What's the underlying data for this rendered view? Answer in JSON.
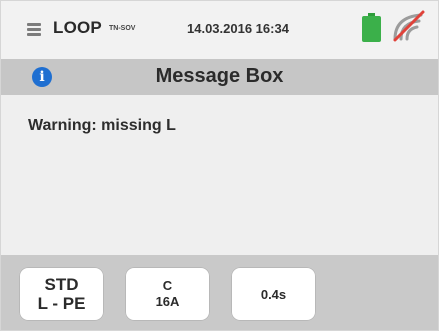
{
  "status_bar": {
    "mode": "LOOP",
    "mode_subscript": "TN-SOV",
    "datetime": "14.03.2016 16:34",
    "battery_icon": "battery-full-icon",
    "battery_color": "#3bb04a",
    "signal_icon": "signal-off-icon",
    "signal_off_color": "#e0423a"
  },
  "title_bar": {
    "icon": "info-icon",
    "title": "Message Box"
  },
  "content": {
    "message": "Warning: missing L"
  },
  "softkeys": [
    {
      "line1": "STD",
      "line2": "L - PE"
    },
    {
      "line1": "C",
      "line2": "16A"
    },
    {
      "line1": "0.4s",
      "line2": ""
    }
  ],
  "colors": {
    "info_blue": "#1f6fd1",
    "title_bar_bg": "#c6c6c6",
    "bottom_bar_bg": "#c9c9c9"
  }
}
